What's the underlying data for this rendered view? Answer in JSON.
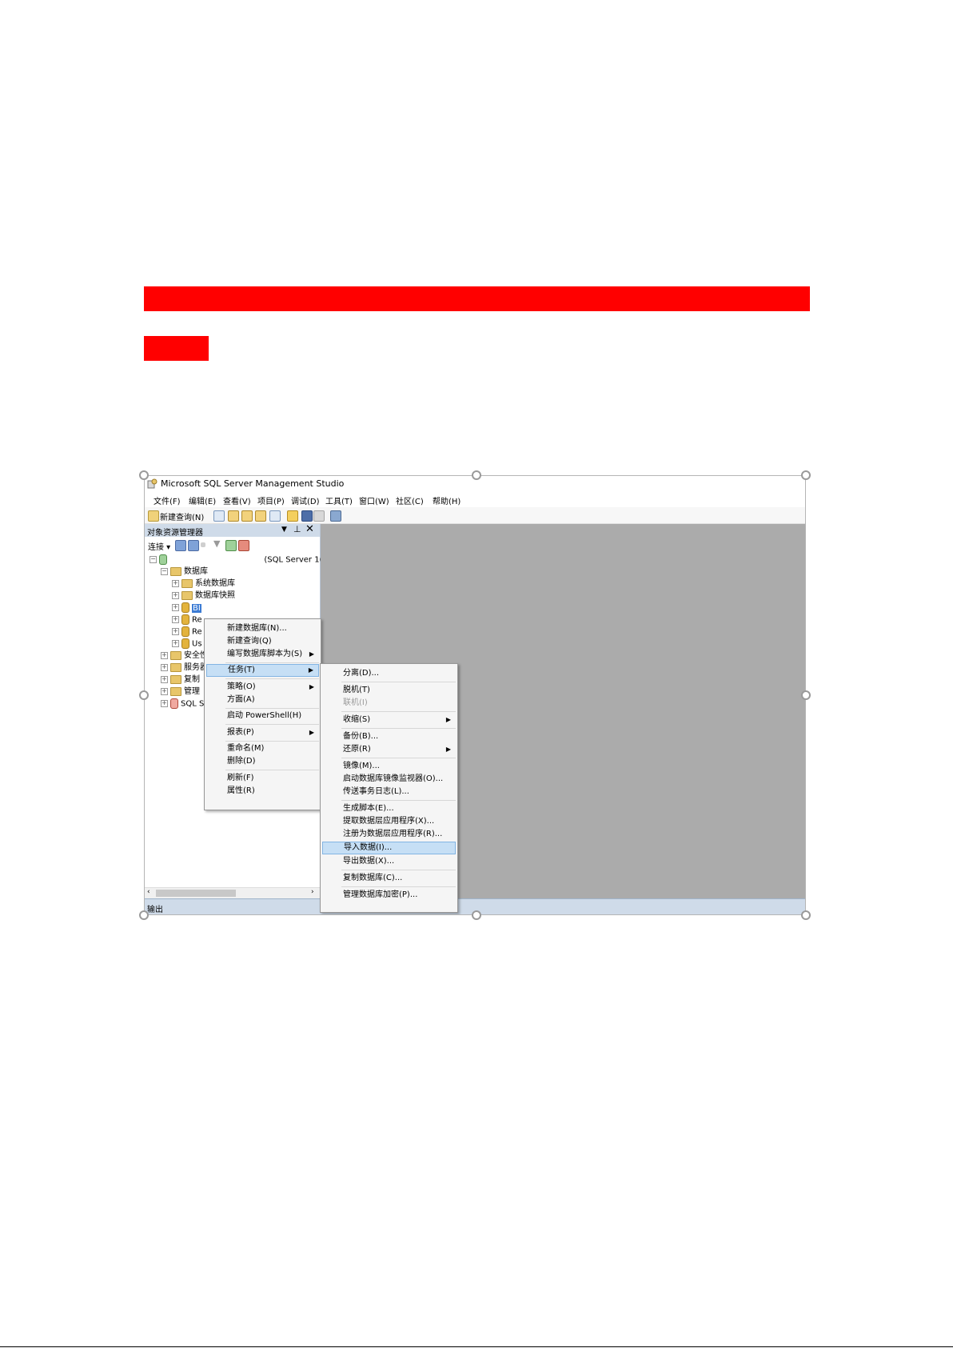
{
  "window": {
    "title": "Microsoft SQL Server Management Studio"
  },
  "menubar": [
    "文件(F)",
    "编辑(E)",
    "查看(V)",
    "项目(P)",
    "调试(D)",
    "工具(T)",
    "窗口(W)",
    "社区(C)",
    "帮助(H)"
  ],
  "toolbar": {
    "new_query": "新建查询(N)"
  },
  "explorer": {
    "title": "对象资源管理器",
    "connect": "连接",
    "server_suffix": "(SQL Server 1(",
    "tree": {
      "databases": "数据库",
      "system_db": "系统数据库",
      "snapshots": "数据库快照",
      "db1": "BI",
      "db2": "Re",
      "db3": "Re",
      "db4": "Us",
      "security": "安全性",
      "server_objects": "服务器",
      "replication": "复制",
      "management": "管理",
      "agent": "SQL S"
    }
  },
  "context_menu": {
    "items": [
      "新建数据库(N)...",
      "新建查询(Q)",
      "编写数据库脚本为(S)",
      "任务(T)",
      "策略(O)",
      "方面(A)",
      "启动 PowerShell(H)",
      "报表(P)",
      "重命名(M)",
      "删除(D)",
      "刷新(F)",
      "属性(R)"
    ]
  },
  "tasks_menu": {
    "items": [
      "分离(D)...",
      "脱机(T)",
      "联机(I)",
      "收缩(S)",
      "备份(B)...",
      "还原(R)",
      "镜像(M)...",
      "启动数据库镜像监视器(O)...",
      "传送事务日志(L)...",
      "生成脚本(E)...",
      "提取数据层应用程序(X)...",
      "注册为数据层应用程序(R)...",
      "导入数据(I)...",
      "导出数据(X)...",
      "复制数据库(C)...",
      "管理数据库加密(P)..."
    ]
  },
  "output": {
    "label": "输出"
  },
  "colors": {
    "redaction": "#ff0000",
    "highlight": "#c6dff5",
    "panel_header": "#cfdbe9",
    "workspace": "#ababab"
  }
}
